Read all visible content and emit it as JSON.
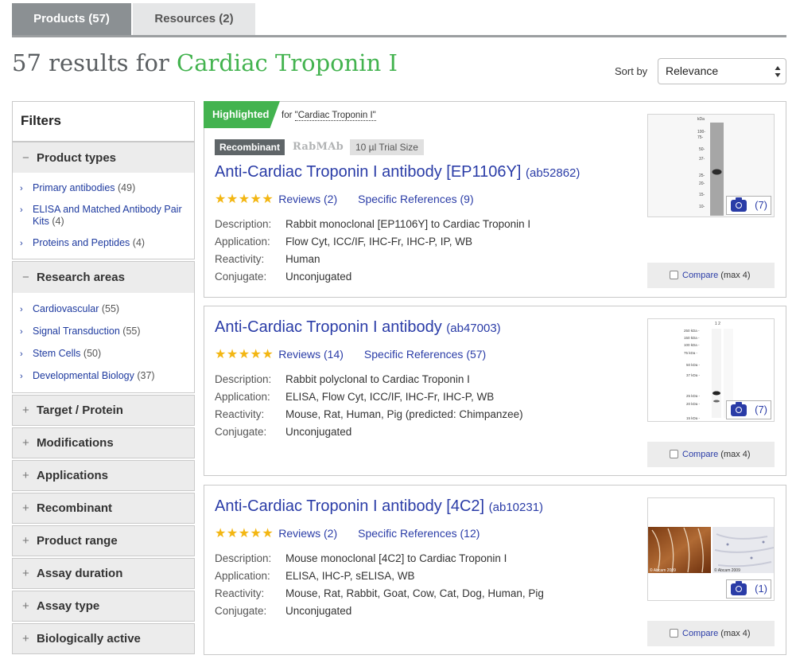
{
  "tabs": [
    {
      "label": "Products (57)"
    },
    {
      "label": "Resources (2)"
    }
  ],
  "header": {
    "results_prefix": "57 results for ",
    "search_term": "Cardiac Troponin I",
    "sort_label": "Sort by",
    "sort_value": "Relevance"
  },
  "sidebar": {
    "title": "Filters",
    "groups": [
      {
        "label": "Product types",
        "items": [
          {
            "label": "Primary antibodies",
            "count": "(49)"
          },
          {
            "label": "ELISA and Matched Antibody Pair Kits",
            "count": "(4)"
          },
          {
            "label": "Proteins and Peptides",
            "count": "(4)"
          }
        ]
      },
      {
        "label": "Research areas",
        "items": [
          {
            "label": "Cardiovascular",
            "count": "(55)"
          },
          {
            "label": "Signal Transduction",
            "count": "(55)"
          },
          {
            "label": "Stem Cells",
            "count": "(50)"
          },
          {
            "label": "Developmental Biology",
            "count": "(37)"
          }
        ]
      }
    ],
    "collapsed": [
      "Target / Protein",
      "Modifications",
      "Applications",
      "Recombinant",
      "Product range",
      "Assay duration",
      "Assay type",
      "Biologically active"
    ]
  },
  "products": [
    {
      "highlight": "Highlighted",
      "highlight_for": "for ",
      "highlight_query": "\"Cardiac Troponin I\"",
      "badge_recombinant": "Recombinant",
      "badge_rabmab": "RabMAb",
      "badge_trial": "10 µl Trial Size",
      "title": "Anti-Cardiac Troponin I antibody [EP1106Y]",
      "code": "(ab52862)",
      "stars": "★★★★★",
      "reviews": "Reviews (2)",
      "references": "Specific References (9)",
      "label_description": "Description:",
      "label_application": "Application:",
      "label_reactivity": "Reactivity:",
      "label_conjugate": "Conjugate:",
      "description": "Rabbit monoclonal [EP1106Y] to Cardiac Troponin I",
      "application": "Flow Cyt, ICC/IF, IHC-Fr, IHC-P, IP, WB",
      "reactivity": "Human",
      "conjugate": "Unconjugated",
      "image_count": "(7)",
      "compare_link": "Compare",
      "compare_max": " (max 4)",
      "blot_kda": "kDa",
      "blot_markers": [
        "100-",
        "75-",
        "50-",
        "37-",
        "25-",
        "20-",
        "15-",
        "10-"
      ]
    },
    {
      "title": "Anti-Cardiac Troponin I antibody",
      "code": "(ab47003)",
      "stars": "★★★★★",
      "reviews": "Reviews (14)",
      "references": "Specific References (57)",
      "label_description": "Description:",
      "label_application": "Application:",
      "label_reactivity": "Reactivity:",
      "label_conjugate": "Conjugate:",
      "description": "Rabbit polyclonal to Cardiac Troponin I",
      "application": "ELISA, Flow Cyt, ICC/IF, IHC-Fr, IHC-P, WB",
      "reactivity": "Mouse, Rat, Human, Pig (predicted: Chimpanzee)",
      "conjugate": "Unconjugated",
      "image_count": "(7)",
      "compare_link": "Compare",
      "compare_max": " (max 4)",
      "blot_lanes": "1   2",
      "blot_markers": [
        "250 kDa -",
        "150 kDa -",
        "100 kDa -",
        "75 kDa -",
        "50 kDa -",
        "37 kDa -",
        "25 kDa -",
        "20 kDa -",
        "15 kDa -"
      ]
    },
    {
      "title": "Anti-Cardiac Troponin I antibody [4C2]",
      "code": "(ab10231)",
      "stars": "★★★★★",
      "reviews": "Reviews (2)",
      "references": "Specific References (12)",
      "label_description": "Description:",
      "label_application": "Application:",
      "label_reactivity": "Reactivity:",
      "label_conjugate": "Conjugate:",
      "description": "Mouse monoclonal [4C2] to Cardiac Troponin I",
      "application": "ELISA, IHC-P, sELISA, WB",
      "reactivity": "Mouse, Rat, Rabbit, Goat, Cow, Cat, Dog, Human, Pig",
      "conjugate": "Unconjugated",
      "image_count": "(1)",
      "compare_link": "Compare",
      "compare_max": " (max 4)",
      "copyright_1": "© Abcam 2009",
      "copyright_2": "© Abcam 2009"
    }
  ],
  "colors": {
    "accent_green": "#43b34f",
    "link_blue": "#2a3ca7",
    "star_gold": "#f3b612",
    "tab_active": "#8b9093"
  }
}
